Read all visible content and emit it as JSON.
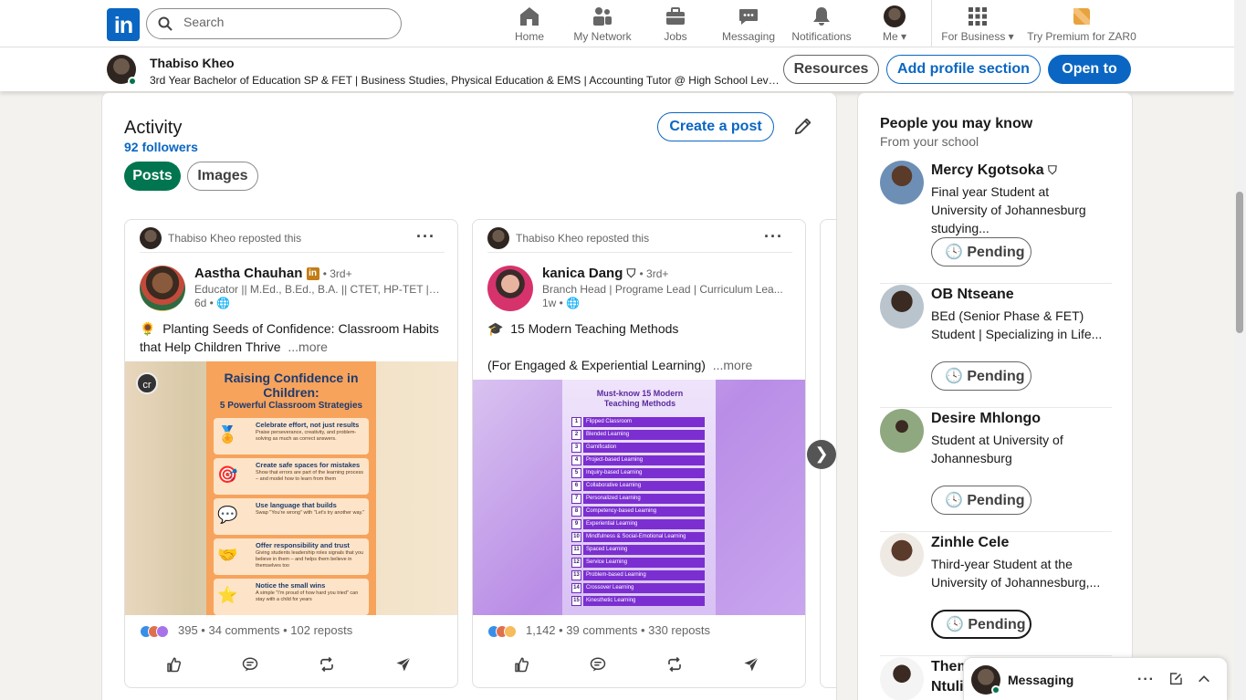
{
  "nav": {
    "logo": "in",
    "search_placeholder": "Search",
    "items": [
      {
        "label": "Home",
        "icon": "home-icon"
      },
      {
        "label": "My Network",
        "icon": "network-icon"
      },
      {
        "label": "Jobs",
        "icon": "briefcase-icon"
      },
      {
        "label": "Messaging",
        "icon": "messaging-icon"
      },
      {
        "label": "Notifications",
        "icon": "bell-icon"
      },
      {
        "label": "Me",
        "icon": "avatar"
      }
    ],
    "for_business": "For Business",
    "premium": "Try Premium for ZAR0"
  },
  "profile_bar": {
    "name": "Thabiso Kheo",
    "headline": "3rd Year Bachelor of Education SP & FET | Business Studies, Physical Education & EMS | Accounting Tutor @ High School Level | E...",
    "resources": "Resources",
    "add_section": "Add profile section",
    "open_to": "Open to"
  },
  "activity": {
    "title": "Activity",
    "followers": "92 followers",
    "create_post": "Create a post",
    "tabs": [
      "Posts",
      "Images"
    ],
    "posts": [
      {
        "repost_text": "Thabiso Kheo reposted this",
        "author": "Aastha Chauhan",
        "degree": "• 3rd+",
        "subtitle": "Educator || M.Ed., B.Ed., B.A. || CTET, HP-TET || ...",
        "time": "6d •",
        "body_icon": "🌻",
        "body": "Planting Seeds of Confidence: Classroom Habits that Help Children Thrive",
        "more": "...more",
        "stats": "395 • 34 comments • 102 reposts",
        "infographic": {
          "title": "Raising Confidence in Children:",
          "subtitle": "5 Powerful Classroom Strategies",
          "badge": "cr",
          "items": [
            {
              "head": "Celebrate effort, not just results",
              "text": "Praise perseverance, creativity, and problem-solving as much as correct answers."
            },
            {
              "head": "Create safe spaces for mistakes",
              "text": "Show that errors are part of the learning process – and model how to learn from them"
            },
            {
              "head": "Use language that builds",
              "text": "Swap \"You're wrong\" with \"Let's try another way.\""
            },
            {
              "head": "Offer responsibility and trust",
              "text": "Giving students leadership roles signals that you believe in them – and helps them believe in themselves too"
            },
            {
              "head": "Notice the small wins",
              "text": "A simple \"I'm proud of how hard you tried\" can stay with a child for years"
            }
          ]
        }
      },
      {
        "repost_text": "Thabiso Kheo reposted this",
        "author": "kanica Dang",
        "degree": "• 3rd+",
        "subtitle": "Branch Head | Programe Lead | Curriculum Lea...",
        "time": "1w •",
        "body_icon": "🎓",
        "body": "15 Modern Teaching Methods",
        "body2": "(For Engaged & Experiential Learning)",
        "more": "...more",
        "stats": "1,142 • 39 comments • 330 reposts",
        "infographic": {
          "title": "Must-know 15 Modern Teaching Methods",
          "items": [
            "Flipped Classroom",
            "Blended Learning",
            "Gamification",
            "Project-based Learning",
            "Inquiry-based Learning",
            "Collaborative Learning",
            "Personalized Learning",
            "Competency-based Learning",
            "Experiential Learning",
            "Mindfulness & Social-Emotional Learning",
            "Spaced Learning",
            "Service Learning",
            "Problem-based Learning",
            "Crossover Learning",
            "Kinesthetic Learning"
          ]
        }
      }
    ]
  },
  "rail": {
    "title": "People you may know",
    "subtitle": "From your school",
    "people": [
      {
        "name": "Mercy Kgotsoka",
        "headline": "Final year Student at University of Johannesburg studying...",
        "button": "Pending"
      },
      {
        "name": "OB Ntseane",
        "headline": "BEd (Senior Phase & FET) Student | Specializing in Life...",
        "button": "Pending"
      },
      {
        "name": "Desire Mhlongo",
        "headline": "Student at University of Johannesburg",
        "button": "Pending"
      },
      {
        "name": "Zinhle Cele",
        "headline": "Third-year Student at the University of Johannesburg,...",
        "button": "Pending"
      },
      {
        "name": "Them",
        "headline": "Ntuli",
        "button": ""
      }
    ]
  },
  "messaging": {
    "label": "Messaging"
  },
  "colors": {
    "brand": "#0a66c2",
    "green": "#01754f"
  }
}
